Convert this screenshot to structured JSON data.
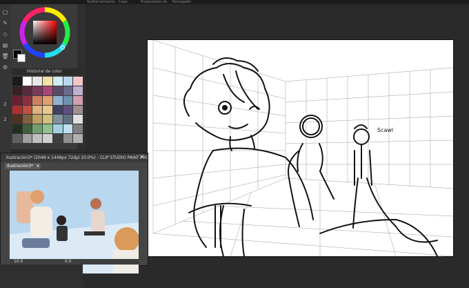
{
  "window_tabs": [
    "Subherramienta",
    "Capa",
    "Propiedades de la capa",
    "Navegador"
  ],
  "color_history": {
    "title": "Historial de color"
  },
  "colors": {
    "accent": "#3a7bd5",
    "canvas_bg": "#ffffff",
    "app_bg": "#2a2a2a"
  },
  "palette_swatches": [
    "#1a1a1a",
    "#ffffff",
    "#e8e8e8",
    "#f2e2a8",
    "#cdeef2",
    "#b9d9f0",
    "#f5c6c6",
    "#3a2020",
    "#5a2a40",
    "#7a3a5a",
    "#a8467a",
    "#5a4a6a",
    "#6a6a8a",
    "#c0b0d0",
    "#6a2030",
    "#8a3040",
    "#d08060",
    "#e0a070",
    "#90b0d0",
    "#7090b0",
    "#d0a0b0",
    "#b03030",
    "#c05040",
    "#e0b080",
    "#e8c890",
    "#404060",
    "#605080",
    "#a09090",
    "#503020",
    "#806040",
    "#c0a060",
    "#d0c080",
    "#8090a0",
    "#607080",
    "#e0e0e0",
    "#203020",
    "#406040",
    "#70a070",
    "#90c090",
    "#a0d0e0",
    "#c0e0f0",
    "#808080",
    "#606060",
    "#a0a0a0",
    "#c0c0c0",
    "#d0d0d0",
    "#404040",
    "#909090",
    "#b0b0b0"
  ],
  "preview": {
    "title": "Ilustración3* (2048 x 1448px 72dpi 10.0%) - CLIP STUDIO PAINT PRO",
    "tab_label": "Ilustración3*",
    "zoom": "10.0",
    "angle": "0.0"
  },
  "sketch": {
    "caption": "Scawl"
  },
  "side_labels": [
    "2",
    "2",
    "Ro",
    "Ro",
    "Ro"
  ]
}
